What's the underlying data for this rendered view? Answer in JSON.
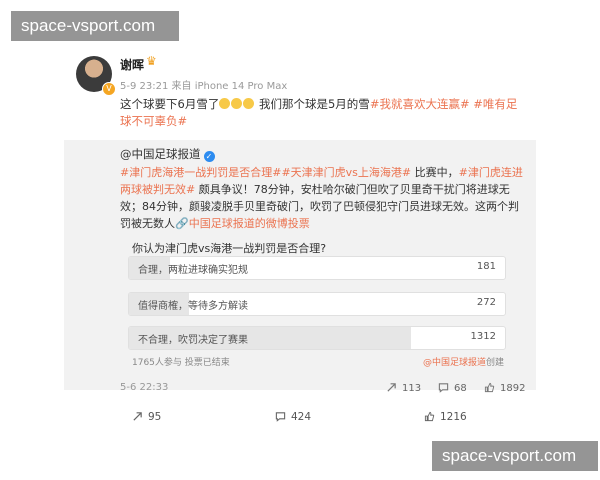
{
  "watermarks": {
    "top": "space-vsport.com",
    "bottom": "space-vsport.com"
  },
  "post": {
    "author_name": "谢晖",
    "timestamp": "5-9 23:21",
    "source": "来自 iPhone 14 Pro Max",
    "text_part1": "这个球要下6月雪了",
    "text_part2": " 我们那个球是5月的雪",
    "hashtag1": "#我就喜欢大连赢#",
    "hashtag2": "#唯有足球不可辜负#",
    "emoji_count": 3
  },
  "repost": {
    "author": "@中国足球报道",
    "hashtag1": "#津门虎海港一战判罚是否合理#",
    "hashtag2": "#天津津门虎vs上海海港#",
    "text1": " 比赛中，",
    "hashtag3": "#津门虎连进两球被判无效#",
    "text2": " 颇具争议！78分钟，安杜哈尔破门但吹了贝里奇干扰门将进球无效；84分钟，颜骏凌脱手贝里奇破门，吹罚了巴顿侵犯守门员进球无效。这两个判罚被无数人",
    "link_text": "中国足球报道的微博投票",
    "time": "5-6 22:33",
    "reposts": "113",
    "comments": "68",
    "likes": "1892"
  },
  "poll": {
    "question": "你认为津门虎vs海港一战判罚是否合理?",
    "options": [
      {
        "label": "合理，两粒进球确实犯规",
        "count": "181",
        "share": 0.11
      },
      {
        "label": "值得商榷，等待多方解读",
        "count": "272",
        "share": 0.16
      },
      {
        "label": "不合理，吹罚决定了赛果",
        "count": "1312",
        "share": 0.75
      }
    ],
    "footer": "1765人参与  投票已结束",
    "creator_link": "@中国足球报道",
    "creator_suffix": "创建"
  },
  "actions": {
    "reposts": "95",
    "comments": "424",
    "likes": "1216"
  },
  "colors": {
    "hashtag": "#eb7350",
    "verified": "#2d8cf0",
    "vip": "#f5a623"
  }
}
